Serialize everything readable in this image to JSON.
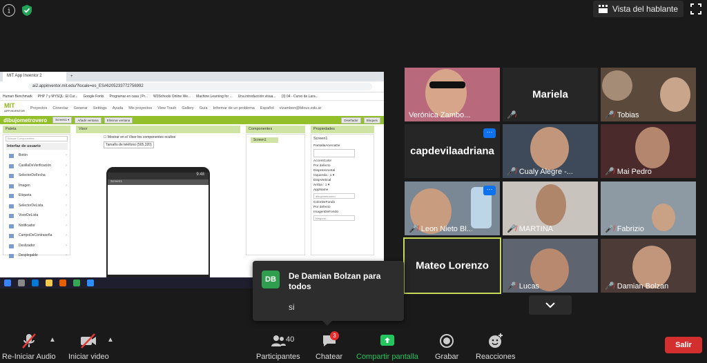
{
  "top": {
    "speaker_view_label": "Vista del hablante"
  },
  "shared_screen": {
    "tab_title": "MIT App Inventor 2",
    "url_text": "ai2.appinventor.mit.edu/?locale=es_ES#6205233772756992",
    "bookmarks": [
      "Human Benchmark",
      "PHP 7 y MYSQL: El Cur...",
      "Google Fonts",
      "Programar en casa | Pr...",
      "W3Schools Online We...",
      "Machine Learning for ...",
      "Una introducción visua...",
      "(3) 04 - Curso de Lara..."
    ],
    "app_logo": "MIT",
    "app_logo_sub": "APP INVENTOR",
    "menu": [
      "Proyectos",
      "Conectar",
      "Generar",
      "Settings",
      "Ayuda",
      "Mis proyectos",
      "View Trash",
      "Gallery",
      "Guía",
      "Informar de un problema",
      "Español",
      "vizambon@biloux.edu.ar"
    ],
    "project_name": "dibujometrovero",
    "screen_btn": "Screen1 ▾",
    "add_screen": "Añadir ventana",
    "remove_screen": "Eliminar ventana",
    "designer_btn": "Diseñador",
    "blocks_btn": "Bloques",
    "palette_title": "Paleta",
    "palette_search": "Buscar Componentes",
    "palette_category": "Interfaz de usuario",
    "palette_items": [
      "Botón",
      "CasillaDeVerificación",
      "SelectorDeFecha",
      "Imagen",
      "Etiqueta",
      "SelectorDeLista",
      "VisorDeLista",
      "Notificador",
      "CampoDeContraseña",
      "Deslizador",
      "Desplegable"
    ],
    "visor_title": "Visor",
    "visor_checkbox": "Mostrar en el Visor los componentes ocultos",
    "visor_size": "Tamaño de teléfono (505,320)",
    "phone_time": "9:48",
    "phone_screen_title": "Screen1",
    "components_title": "Componentes",
    "components_item": "Screen1",
    "props_title": "Propiedades",
    "props_screen": "Screen1",
    "props": [
      {
        "label": "PantallaAcercaDe",
        "value": ""
      },
      {
        "label": "AccentColor",
        "value": "Por defecto"
      },
      {
        "label": "DispHorizontal",
        "value": "Izquierda : 1 ▾"
      },
      {
        "label": "DispVertical",
        "value": "Arriba : 1 ▾"
      },
      {
        "label": "AppName",
        "value": "dibujometrovero"
      },
      {
        "label": "ColorDeFondo",
        "value": "Por defecto"
      },
      {
        "label": "ImagenDeFondo",
        "value": "Ninguno..."
      }
    ]
  },
  "participants": [
    {
      "name": "Verónica Zambo...",
      "muted": false
    },
    {
      "name": "Mariela",
      "muted": true
    },
    {
      "name": "Tobias",
      "muted": true
    },
    {
      "name": "capdevilaadriana",
      "muted": false
    },
    {
      "name": "Cualy Alegre -...",
      "muted": true
    },
    {
      "name": "Mai Pedro",
      "muted": true
    },
    {
      "name": "Leon Nieto Bl...",
      "muted": true
    },
    {
      "name": "MARTINA",
      "muted": true
    },
    {
      "name": "Fabrizio",
      "muted": true
    },
    {
      "name": "Mateo Lorenzo",
      "muted": false
    },
    {
      "name": "Lucas",
      "muted": true
    },
    {
      "name": "Damian Bolzan",
      "muted": true
    }
  ],
  "chat_popup": {
    "avatar": "DB",
    "from": "De Damian Bolzan para todos",
    "message": "si"
  },
  "toolbar": {
    "audio_label": "Re-Iniciar Audio",
    "video_label": "Iniciar video",
    "participants_label": "Participantes",
    "participants_count": "40",
    "chat_label": "Chatear",
    "chat_badge": "3",
    "share_label": "Compartir pantalla",
    "record_label": "Grabar",
    "reactions_label": "Reacciones",
    "leave_label": "Salir"
  },
  "colors": {
    "share_green": "#22c55e",
    "leave_red": "#d32f2f",
    "active_speaker": "#c9db5b",
    "more_blue": "#0e72ed"
  }
}
